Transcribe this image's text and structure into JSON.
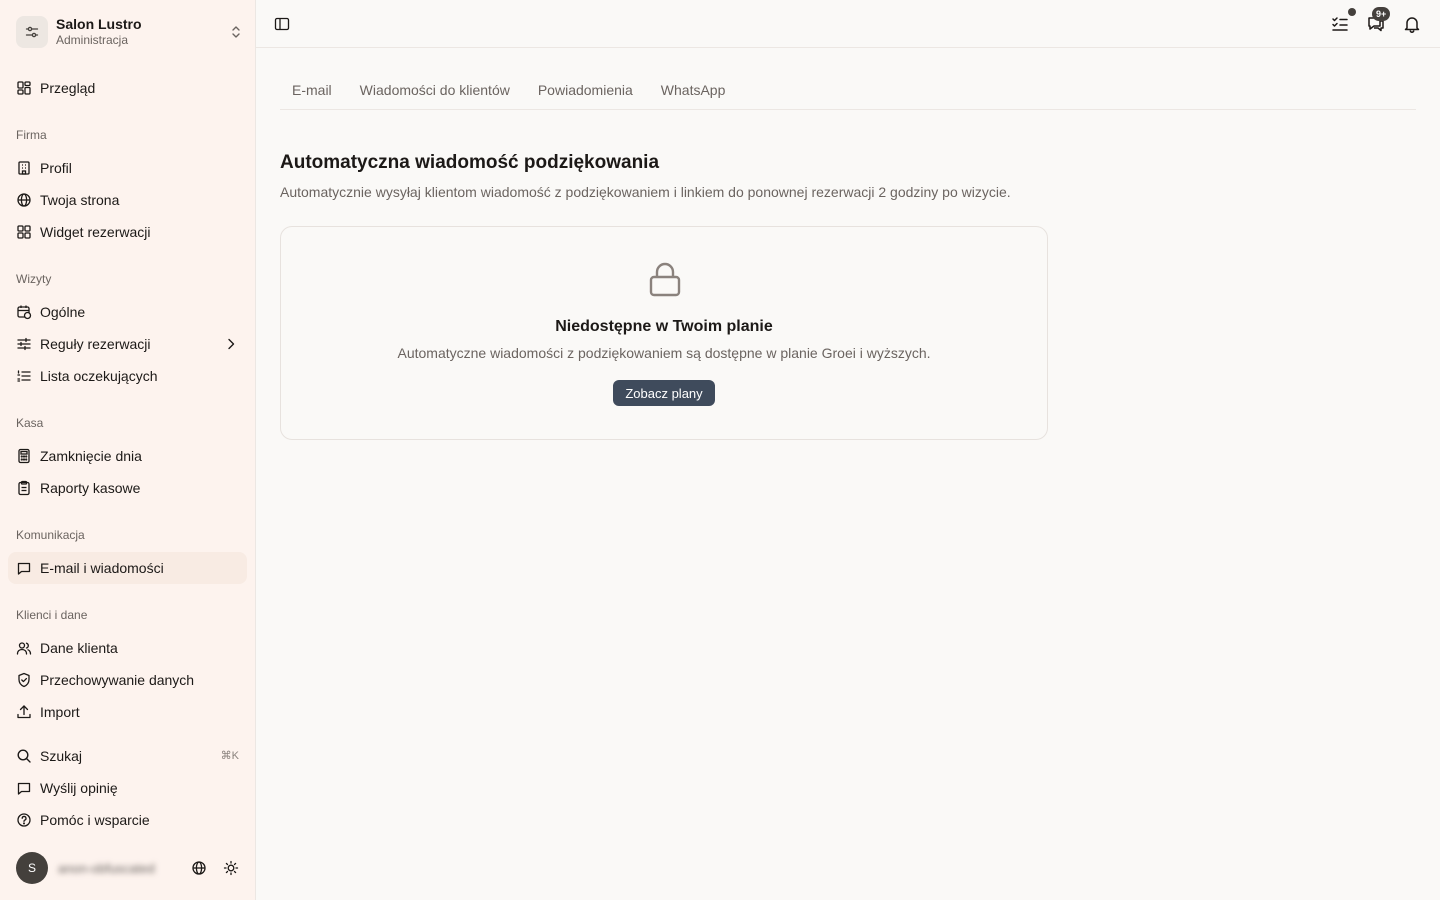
{
  "org": {
    "name": "Salon Lustro",
    "role": "Administracja"
  },
  "nav": {
    "overview": "Przegląd",
    "sections": {
      "firma": "Firma",
      "wizyty": "Wizyty",
      "kasa": "Kasa",
      "komunikacja": "Komunikacja",
      "klienci": "Klienci i dane"
    },
    "items": {
      "profil": "Profil",
      "strona": "Twoja strona",
      "widget": "Widget rezerwacji",
      "ogolne": "Ogólne",
      "reguly": "Reguły rezerwacji",
      "lista": "Lista oczekujących",
      "zamkniecie": "Zamknięcie dnia",
      "raporty": "Raporty kasowe",
      "email": "E-mail i wiadomości",
      "dane": "Dane klienta",
      "przechowywanie": "Przechowywanie danych",
      "import": "Import"
    },
    "footer": {
      "search": "Szukaj",
      "search_shortcut": "⌘K",
      "feedback": "Wyślij opinię",
      "help": "Pomóc i wsparcie"
    }
  },
  "user": {
    "initial": "S",
    "name": "anon-obfuscated"
  },
  "topbar": {
    "chat_badge": "9+"
  },
  "tabs": [
    "E-mail",
    "Wiadomości do klientów",
    "Powiadomienia",
    "WhatsApp"
  ],
  "page": {
    "title": "Automatyczna wiadomość podziękowania",
    "description": "Automatycznie wysyłaj klientom wiadomość z podziękowaniem i linkiem do ponownej rezerwacji 2 godziny po wizycie."
  },
  "locked_card": {
    "title": "Niedostępne w Twoim planie",
    "description": "Automatyczne wiadomości z podziękowaniem są dostępne w planie Groei i wyższych.",
    "button": "Zobacz plany"
  }
}
